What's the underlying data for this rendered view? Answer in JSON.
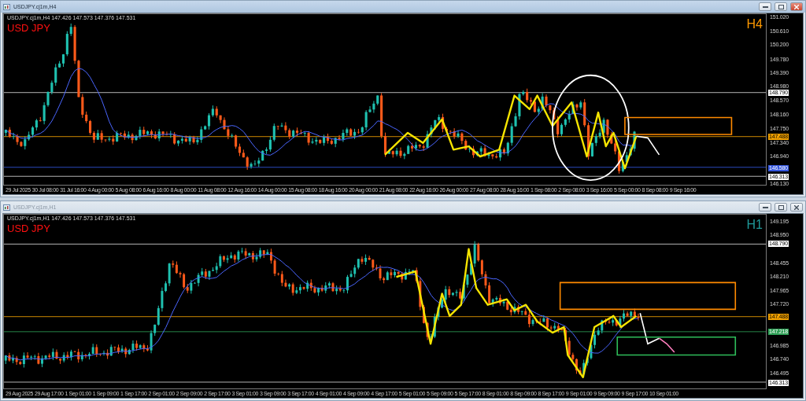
{
  "windows": [
    {
      "title": "USDJPY.cj1m,H4",
      "active": true,
      "info": "USDJPY.cj1m,H4  147.426 147.573 147.376 147.531",
      "symbol": "USD JPY",
      "timeframe": "H4",
      "price_ticks": [
        "151.020",
        "150.610",
        "150.200",
        "149.780",
        "149.390",
        "148.980",
        "148.570",
        "148.160",
        "147.750",
        "147.340",
        "146.940",
        "146.130"
      ],
      "levels": [
        {
          "price": "148.790",
          "color": "#ffffff"
        },
        {
          "price": "147.488",
          "color": "#f0a000"
        },
        {
          "price": "146.580",
          "color": "#3355dd"
        },
        {
          "price": "146.313",
          "color": "#ffffff"
        }
      ],
      "time_labels": [
        "29 Jul 2025",
        "30 Jul 08:00",
        "31 Jul 16:00",
        "4 Aug 00:00",
        "5 Aug 08:00",
        "6 Aug 16:00",
        "8 Aug 00:00",
        "11 Aug 08:00",
        "12 Aug 16:00",
        "14 Aug 00:00",
        "15 Aug 08:00",
        "18 Aug 16:00",
        "20 Aug 00:00",
        "21 Aug 08:00",
        "22 Aug 16:00",
        "26 Aug 00:00",
        "27 Aug 08:00",
        "28 Aug 16:00",
        "1 Sep 08:00",
        "2 Sep 08:00",
        "3 Sep 16:00",
        "5 Sep 00:00",
        "8 Sep 08:00",
        "9 Sep 16:00"
      ]
    },
    {
      "title": "USDJPY.cj1m,H1",
      "active": false,
      "info": "USDJPY.cj1m,H1  147.426 147.573 147.376 147.531",
      "symbol": "USD JPY",
      "timeframe": "H1",
      "price_ticks": [
        "149.195",
        "148.950",
        "148.455",
        "148.210",
        "147.965",
        "147.720",
        "146.985",
        "146.740",
        "146.495"
      ],
      "levels": [
        {
          "price": "148.790",
          "color": "#ffffff"
        },
        {
          "price": "147.488",
          "color": "#f0a000"
        },
        {
          "price": "147.218",
          "color": "#2e9e55"
        },
        {
          "price": "146.313",
          "color": "#ffffff"
        }
      ],
      "time_labels": [
        "29 Aug 2025",
        "29 Aug 17:00",
        "1 Sep 01:00",
        "1 Sep 09:00",
        "1 Sep 17:00",
        "2 Sep 01:00",
        "2 Sep 09:00",
        "2 Sep 17:00",
        "3 Sep 01:00",
        "3 Sep 09:00",
        "3 Sep 17:00",
        "4 Sep 01:00",
        "4 Sep 09:00",
        "4 Sep 17:00",
        "5 Sep 01:00",
        "5 Sep 09:00",
        "5 Sep 17:00",
        "8 Sep 01:00",
        "8 Sep 09:00",
        "8 Sep 17:00",
        "9 Sep 01:00",
        "9 Sep 09:00",
        "9 Sep 17:00",
        "10 Sep 01:00"
      ]
    }
  ]
}
